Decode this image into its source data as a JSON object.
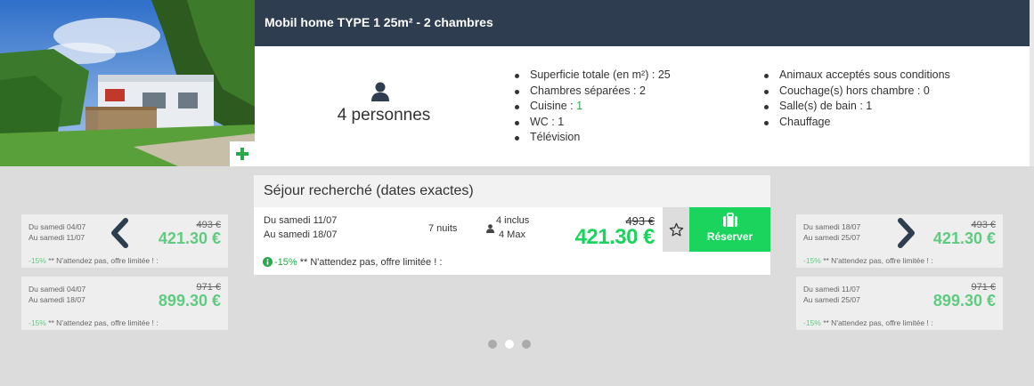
{
  "listing": {
    "title": "Mobil home TYPE 1 25m² - 2 chambres",
    "persons": "4 personnes",
    "features_left": [
      {
        "label": "Superficie totale (en m²) : ",
        "value": "25"
      },
      {
        "label": "Chambres séparées : ",
        "value": "2"
      },
      {
        "label": "Cuisine : ",
        "value": "1"
      },
      {
        "label": "WC : ",
        "value": "1"
      },
      {
        "label": "Télévision",
        "value": ""
      }
    ],
    "features_right": [
      {
        "label": "Animaux acceptés sous conditions",
        "value": ""
      },
      {
        "label": "Couchage(s) hors chambre : ",
        "value": "0"
      },
      {
        "label": "Salle(s) de bain : ",
        "value": "1"
      },
      {
        "label": "Chauffage",
        "value": ""
      }
    ]
  },
  "search": {
    "heading": "Séjour recherché (dates exactes)",
    "from": "Du samedi 11/07",
    "to": "Au samedi 18/07",
    "nights": "7 nuits",
    "included": "4 inclus",
    "max": "4 Max",
    "old_price": "493 €",
    "new_price": "421.30 €",
    "reserve_label": "Réserver",
    "promo_pct": "-15%",
    "promo_text": " ** N'attendez pas, offre limitée ! :"
  },
  "alternatives_left": [
    {
      "from": "Du samedi 04/07",
      "to": "Au samedi 11/07",
      "old_price": "493 €",
      "new_price": "421.30 €",
      "promo_pct": "-15%",
      "promo_text": " ** N'attendez pas, offre limitée ! :"
    },
    {
      "from": "Du samedi 04/07",
      "to": "Au samedi 18/07",
      "old_price": "971 €",
      "new_price": "899.30 €",
      "promo_pct": "-15%",
      "promo_text": " ** N'attendez pas, offre limitée ! :"
    }
  ],
  "alternatives_right": [
    {
      "from": "Du samedi 18/07",
      "to": "Au samedi 25/07",
      "old_price": "493 €",
      "new_price": "421.30 €",
      "promo_pct": "-15%",
      "promo_text": " ** N'attendez pas, offre limitée ! :"
    },
    {
      "from": "Du samedi 11/07",
      "to": "Au samedi 25/07",
      "old_price": "971 €",
      "new_price": "899.30 €",
      "promo_pct": "-15%",
      "promo_text": " ** N'attendez pas, offre limitée ! :"
    }
  ],
  "carousel": {
    "pages": 3,
    "active": 1
  },
  "colors": {
    "header": "#2e3e50",
    "accent": "#1bd45d",
    "promo": "#2aa84c",
    "background": "#dcdcdc"
  },
  "icons": [
    "user-icon",
    "plus-icon",
    "star-icon",
    "suitcase-icon",
    "info-icon",
    "chevron-left-icon",
    "chevron-right-icon"
  ]
}
